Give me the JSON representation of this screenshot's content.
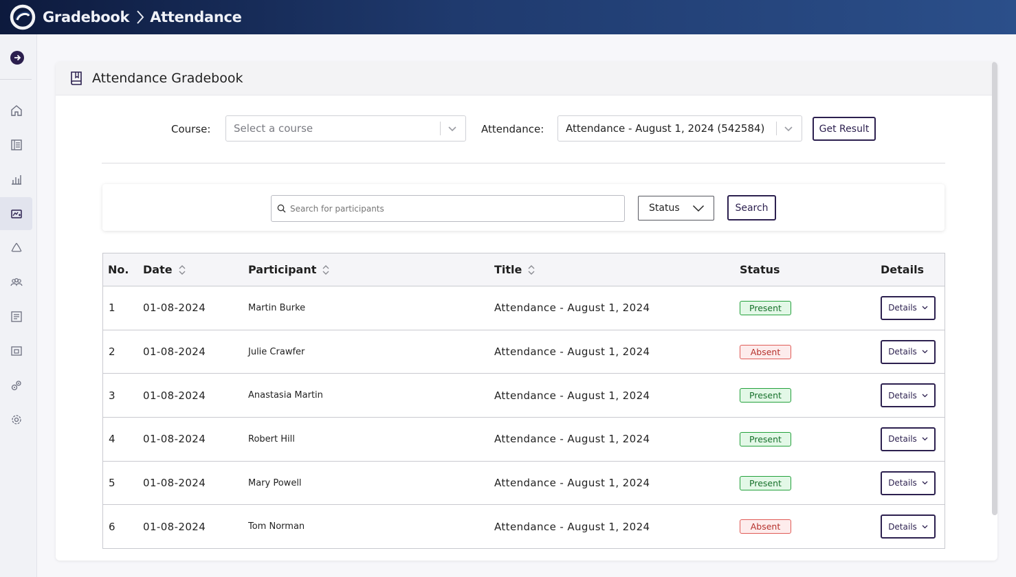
{
  "header": {
    "breadcrumb": [
      {
        "label": "Gradebook"
      },
      {
        "label": "Attendance"
      }
    ]
  },
  "sidebar": {
    "items": [
      {
        "icon": "home-icon"
      },
      {
        "icon": "book-icon"
      },
      {
        "icon": "bar-chart-icon"
      },
      {
        "icon": "gradebook-icon",
        "active": true
      },
      {
        "icon": "recycle-icon"
      },
      {
        "icon": "users-icon"
      },
      {
        "icon": "list-icon"
      },
      {
        "icon": "calendar-icon"
      },
      {
        "icon": "puzzle-icon"
      },
      {
        "icon": "settings-icon"
      }
    ]
  },
  "page": {
    "title": "Attendance Gradebook"
  },
  "filters": {
    "course_label": "Course:",
    "course_placeholder": "Select a course",
    "attendance_label": "Attendance:",
    "attendance_value": "Attendance - August 1, 2024 (542584)",
    "get_result_label": "Get Result"
  },
  "search": {
    "placeholder": "Search for participants",
    "status_label": "Status",
    "search_button": "Search"
  },
  "table": {
    "headers": {
      "no": "No.",
      "date": "Date",
      "participant": "Participant",
      "title": "Title",
      "status": "Status",
      "details": "Details"
    },
    "details_button": "Details",
    "rows": [
      {
        "no": "1",
        "date": "01-08-2024",
        "participant": "Martin Burke",
        "title": "Attendance - August 1, 2024",
        "status": "Present"
      },
      {
        "no": "2",
        "date": "01-08-2024",
        "participant": "Julie Crawfer",
        "title": "Attendance - August 1, 2024",
        "status": "Absent"
      },
      {
        "no": "3",
        "date": "01-08-2024",
        "participant": "Anastasia Martin",
        "title": "Attendance - August 1, 2024",
        "status": "Present"
      },
      {
        "no": "4",
        "date": "01-08-2024",
        "participant": "Robert Hill",
        "title": "Attendance - August 1, 2024",
        "status": "Present"
      },
      {
        "no": "5",
        "date": "01-08-2024",
        "participant": "Mary Powell",
        "title": "Attendance - August 1, 2024",
        "status": "Present"
      },
      {
        "no": "6",
        "date": "01-08-2024",
        "participant": "Tom Norman",
        "title": "Attendance - August 1, 2024",
        "status": "Absent"
      }
    ]
  },
  "colors": {
    "accent": "#2b1f4e",
    "present": "#22a03a",
    "absent": "#e05a55"
  }
}
